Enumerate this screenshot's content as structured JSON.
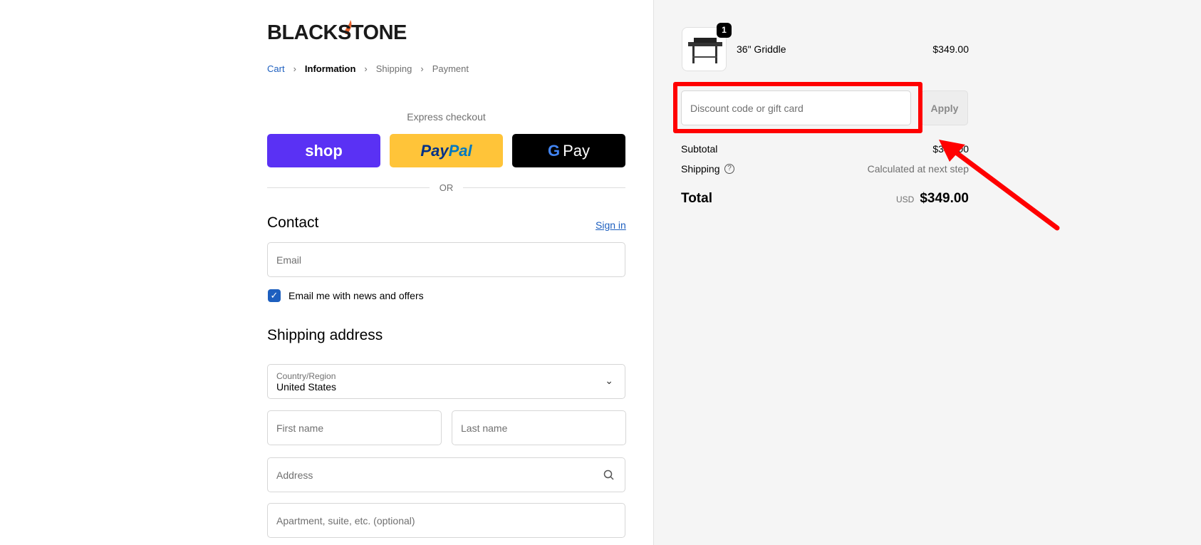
{
  "brand": {
    "logo_text": "BLACKSTONE",
    "flame_color": "#e8622c"
  },
  "breadcrumb": [
    {
      "label": "Cart"
    },
    {
      "label": "Information"
    },
    {
      "label": "Shipping"
    },
    {
      "label": "Payment"
    }
  ],
  "express": {
    "title": "Express checkout",
    "shop": "shop",
    "paypal_a": "Pay",
    "paypal_b": "Pal",
    "gpay": "Pay",
    "or": "OR"
  },
  "contact": {
    "title": "Contact",
    "sign_in": "Sign in",
    "email_placeholder": "Email",
    "newsletter_label": "Email me with news and offers",
    "newsletter_checked": true
  },
  "shipping": {
    "title": "Shipping address",
    "country_label": "Country/Region",
    "country_value": "United States",
    "first_name": "First name",
    "last_name": "Last name",
    "address": "Address",
    "apartment": "Apartment, suite, etc. (optional)"
  },
  "summary": {
    "item": {
      "name": "36\" Griddle",
      "price": "$349.00",
      "quantity": "1"
    },
    "discount_placeholder": "Discount code or gift card",
    "apply": "Apply",
    "subtotal_label": "Subtotal",
    "subtotal": "$349.00",
    "shipping_label": "Shipping",
    "shipping_value": "Calculated at next step",
    "total_label": "Total",
    "currency": "USD",
    "total": "$349.00"
  },
  "colors": {
    "shop": "#5a31f4",
    "paypal": "#ffc439",
    "gpay": "#000000",
    "link": "#1d5fbf",
    "annotation": "#ff0000"
  }
}
